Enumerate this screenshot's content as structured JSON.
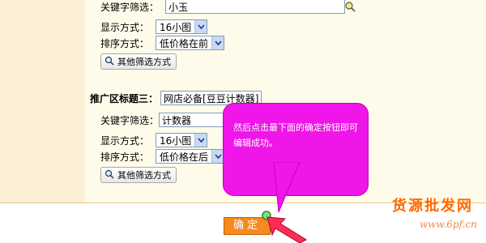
{
  "section_a": {
    "keyword_label": "关键字筛选：",
    "keyword_value": "小玉",
    "display_label": "显示方式：",
    "display_value": "16小图",
    "sort_label": "排序方式：",
    "sort_value": "低价格在前",
    "other_filter_label": "其他筛选方式"
  },
  "section_b": {
    "title_label": "推广区标题三：",
    "title_value": "网店必备[豆豆计数器]",
    "keyword_label": "关键字筛选：",
    "keyword_value": "计数器",
    "display_label": "显示方式：",
    "display_value": "16小图",
    "sort_label": "排序方式：",
    "sort_value": "低价格在后",
    "other_filter_label": "其他筛选方式"
  },
  "callout": {
    "text": "然后点击最下面的确定按钮即可编辑成功。",
    "color": "#f015e8"
  },
  "confirm_button": {
    "label": "确定",
    "color": "#f68a1f"
  },
  "watermark": {
    "brand": "货源批发网",
    "url": "www.6pf.cn"
  }
}
